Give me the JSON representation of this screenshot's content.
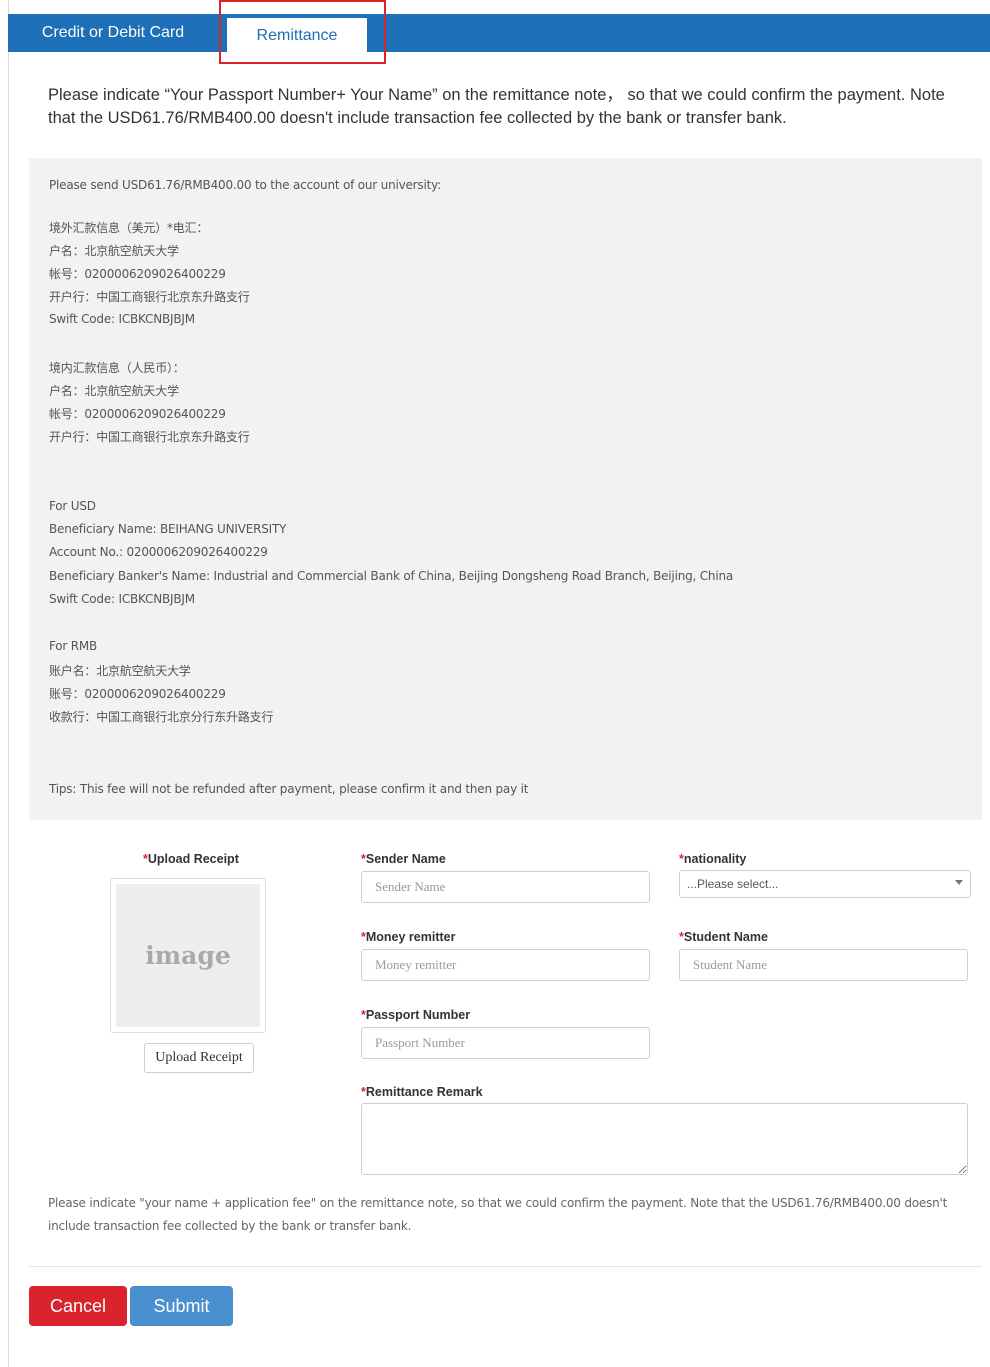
{
  "tabs": {
    "card_label": "Credit or Debit Card",
    "remittance_label": "Remittance"
  },
  "intro": "Please indicate “Your Passport Number+ Your Name” on the remittance note， so that we could confirm the payment. Note that the USD61.76/RMB400.00 doesn't include transaction fee collected by the bank or transfer bank.",
  "account_info": {
    "lines": [
      "Please send USD61.76/RMB400.00 to the account of our university:",
      "境外汇款信息（美元）*电汇：",
      "户名：北京航空航天大学",
      "帐号：0200006209026400229",
      "开户行：中国工商银行北京东升路支行",
      "Swift Code: ICBKCNBJBJM",
      "境内汇款信息（人民币）：",
      "户名：北京航空航天大学",
      "帐号：0200006209026400229",
      "开户行：中国工商银行北京东升路支行",
      "For USD",
      "Beneficiary Name: BEIHANG UNIVERSITY",
      "Account No.: 0200006209026400229",
      "Beneficiary Banker's Name: Industrial and Commercial Bank of China, Beijing Dongsheng Road Branch, Beijing, China",
      "Swift Code: ICBKCNBJBJM",
      "For RMB",
      "账户名：北京航空航天大学",
      "账号：0200006209026400229",
      "收款行：中国工商银行北京分行东升路支行",
      "Tips: This fee will not be refunded after payment, please confirm it and then pay it"
    ]
  },
  "form": {
    "required_mark": "*",
    "upload": {
      "label": "Upload Receipt",
      "placeholder_text": "image",
      "button_label": "Upload Receipt"
    },
    "sender_name": {
      "label": "Sender Name",
      "placeholder": "Sender Name"
    },
    "nationality": {
      "label": "nationality",
      "selected": "...Please select..."
    },
    "money_remitter": {
      "label": "Money remitter",
      "placeholder": "Money remitter"
    },
    "student_name": {
      "label": "Student Name",
      "placeholder": "Student Name"
    },
    "passport_number": {
      "label": "Passport Number",
      "placeholder": "Passport Number"
    },
    "remittance_remark": {
      "label": "Remittance Remark"
    }
  },
  "footer_note": "Please indicate \"your name + application fee\" on the remittance note, so that we could confirm the payment. Note that the USD61.76/RMB400.00 doesn't include transaction fee collected by the bank or transfer bank.",
  "actions": {
    "cancel_label": "Cancel",
    "submit_label": "Submit"
  },
  "colors": {
    "tab_bar": "#1d6fb8",
    "highlight": "#d9232d",
    "cancel": "#d9232d",
    "submit": "#4a90d0"
  }
}
